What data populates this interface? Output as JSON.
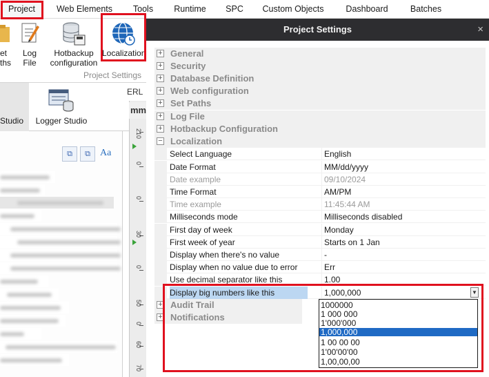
{
  "menu": {
    "items": [
      "Project",
      "Web Elements",
      "Tools",
      "Runtime",
      "SPC",
      "Custom Objects",
      "Dashboard",
      "Batches"
    ]
  },
  "ribbon": {
    "buttons": [
      {
        "label": "et",
        "label2": "ths"
      },
      {
        "label": "Log",
        "label2": "File"
      },
      {
        "label": "Hotbackup",
        "label2": "configuration"
      },
      {
        "label": "Localization",
        "label2": ""
      }
    ],
    "group_label": "Project Settings"
  },
  "studios": {
    "tabs": [
      "Studio",
      "Logger Studio"
    ]
  },
  "left_panel": {
    "font_button": "Aa"
  },
  "ruler": {
    "tab": "ERL",
    "unit": "mm",
    "ticks": [
      "210",
      "0",
      "0",
      "30",
      "0",
      "50",
      "0",
      "60",
      "70"
    ]
  },
  "dialog": {
    "title": "Project Settings",
    "close": "×",
    "categories_collapsed": [
      "General",
      "Security",
      "Database Definition",
      "Web configuration",
      "Set Paths",
      "Log File",
      "Hotbackup Configuration"
    ],
    "expanded_category": "Localization",
    "properties": [
      {
        "name": "Select Language",
        "value": "English",
        "readonly": false
      },
      {
        "name": "Date Format",
        "value": "MM/dd/yyyy",
        "readonly": false
      },
      {
        "name": "Date example",
        "value": "09/10/2024",
        "readonly": true
      },
      {
        "name": "Time Format",
        "value": "AM/PM",
        "readonly": false
      },
      {
        "name": "Time example",
        "value": "11:45:44 AM",
        "readonly": true
      },
      {
        "name": "Milliseconds mode",
        "value": "Milliseconds disabled",
        "readonly": false
      },
      {
        "name": "First day of week",
        "value": "Monday",
        "readonly": false
      },
      {
        "name": "First week of year",
        "value": "Starts on 1 Jan",
        "readonly": false
      },
      {
        "name": "Display when there's no value",
        "value": "-",
        "readonly": false
      },
      {
        "name": "Display when no value due to error",
        "value": "Err",
        "readonly": false
      },
      {
        "name": "Use decimal separator like this",
        "value": "1.00",
        "readonly": false
      },
      {
        "name": "Display big numbers like this",
        "value": "1,000,000",
        "readonly": false
      }
    ],
    "categories_after": [
      "Audit Trail",
      "Notifications"
    ],
    "dropdown_options": [
      "1000000",
      "1 000 000",
      "1'000'000",
      "1,000,000",
      "1 00 00 00",
      "1'00'00'00",
      "1,00,00,00"
    ],
    "dropdown_selected_index": 3
  }
}
